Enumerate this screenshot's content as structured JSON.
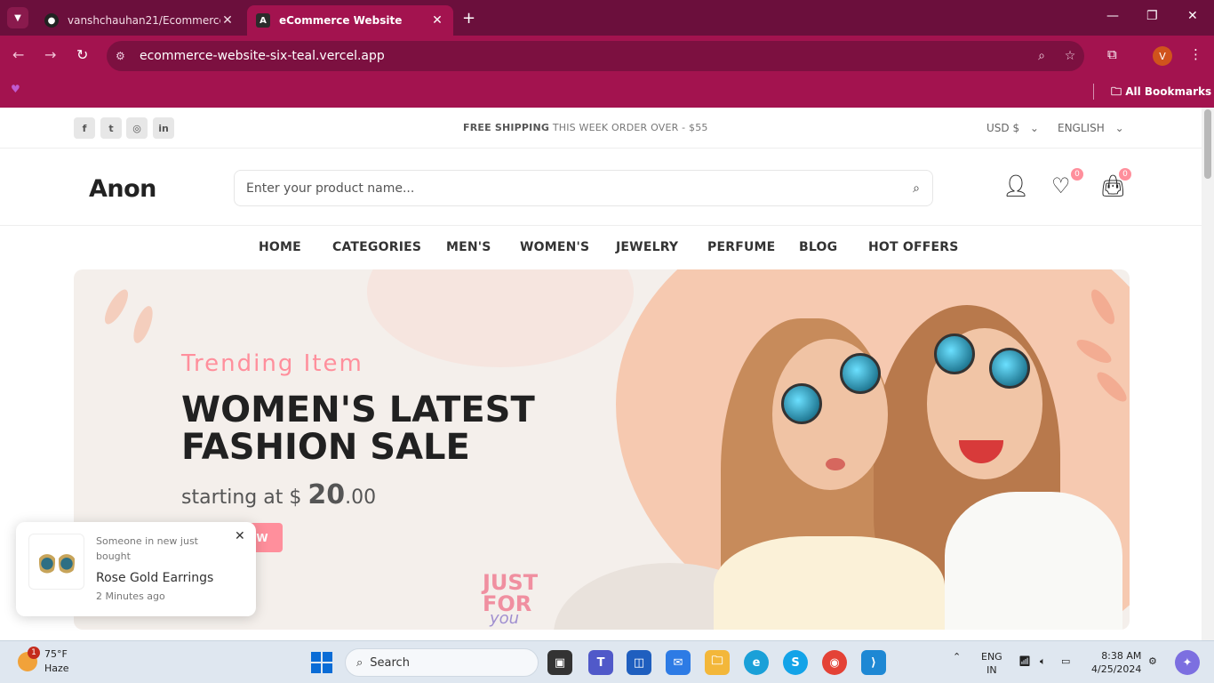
{
  "browser": {
    "tabs": [
      {
        "title": "vanshchauhan21/Ecommerce-w",
        "active": false,
        "icon": "github-icon"
      },
      {
        "title": "eCommerce Website",
        "active": true,
        "icon": "angular-icon"
      }
    ],
    "url": "ecommerce-website-six-teal.vercel.app",
    "profile_initial": "V",
    "all_bookmarks": "All Bookmarks"
  },
  "site": {
    "topbar": {
      "social": [
        "facebook-icon",
        "twitter-icon",
        "instagram-icon",
        "linkedin-icon"
      ],
      "shipping_bold": "FREE SHIPPING",
      "shipping_rest": " THIS WEEK ORDER OVER - $55",
      "currency": "USD $",
      "language": "ENGLISH"
    },
    "header": {
      "logo": "Anon",
      "search_placeholder": "Enter your product name...",
      "wishlist_count": "0",
      "cart_count": "0"
    },
    "menu": [
      "HOME",
      "CATEGORIES",
      "MEN'S",
      "WOMEN'S",
      "JEWELRY",
      "PERFUME",
      "BLOG",
      "HOT OFFERS"
    ],
    "hero": {
      "subtitle": "Trending Item",
      "title": "WOMEN'S LATEST FASHION SALE",
      "price_prefix": "starting at $ ",
      "price_major": "20",
      "price_minor": ".00",
      "button": "SHOP NOW",
      "badge_line1": "JUST",
      "badge_line2": "FOR",
      "badge_line3": "you"
    },
    "toast": {
      "line": "Someone in new just bought",
      "product": "Rose Gold Earrings",
      "time": "2 Minutes ago"
    }
  },
  "taskbar": {
    "weather_temp": "75°F",
    "weather_desc": "Haze",
    "weather_badge": "1",
    "search": "Search",
    "lang1": "ENG",
    "lang2": "IN",
    "time": "8:38 AM",
    "date": "4/25/2024"
  },
  "colors": {
    "accent": "#ff8f9c",
    "browser_frame": "#a3134f",
    "tabbar": "#6b0f3c"
  }
}
